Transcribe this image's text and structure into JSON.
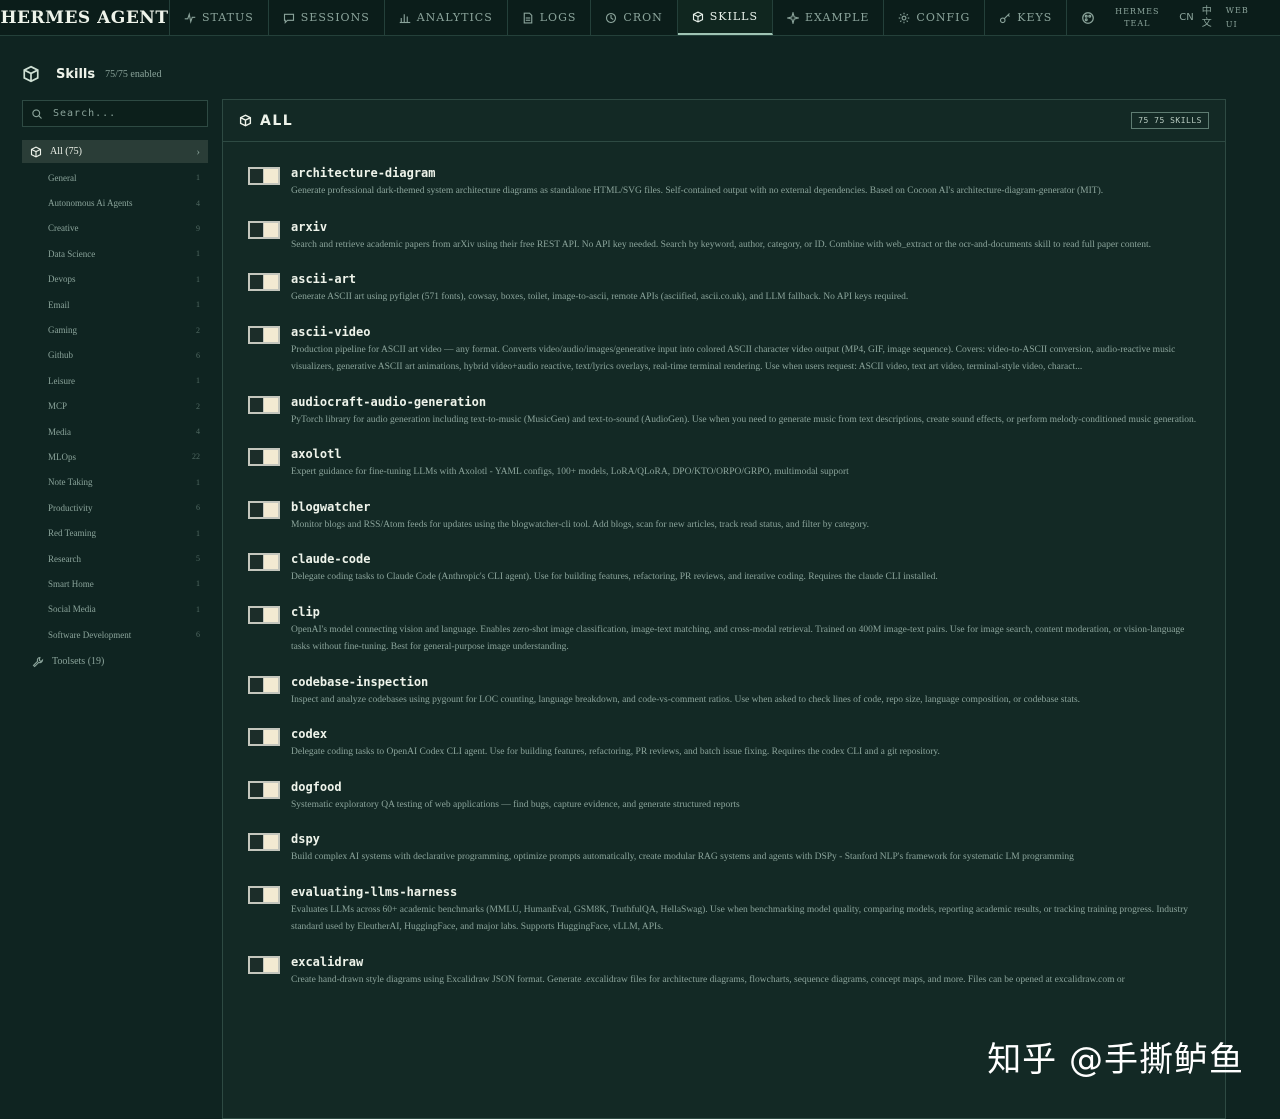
{
  "brand": "HERMES AGENT",
  "nav": {
    "tabs": [
      {
        "label": "STATUS",
        "icon": "pulse-icon"
      },
      {
        "label": "SESSIONS",
        "icon": "chat-icon"
      },
      {
        "label": "ANALYTICS",
        "icon": "bar-chart-icon"
      },
      {
        "label": "LOGS",
        "icon": "document-icon"
      },
      {
        "label": "CRON",
        "icon": "clock-icon"
      },
      {
        "label": "SKILLS",
        "icon": "cube-icon",
        "active": true
      },
      {
        "label": "EXAMPLE",
        "icon": "sparkle-icon"
      },
      {
        "label": "CONFIG",
        "icon": "gear-icon"
      },
      {
        "label": "KEYS",
        "icon": "key-icon"
      }
    ],
    "theme_line1": "HERMES",
    "theme_line2": "TEAL",
    "lang_en": "CN",
    "lang_zh": "中文",
    "webui_line1": "WEB",
    "webui_line2": "UI"
  },
  "page": {
    "title": "Skills",
    "enabled_count": "75/75 enabled"
  },
  "sidebar": {
    "search_placeholder": "Search...",
    "all_label": "All (75)",
    "categories": [
      {
        "label": "General",
        "count": "1"
      },
      {
        "label": "Autonomous Ai Agents",
        "count": "4"
      },
      {
        "label": "Creative",
        "count": "9"
      },
      {
        "label": "Data Science",
        "count": "1"
      },
      {
        "label": "Devops",
        "count": "1"
      },
      {
        "label": "Email",
        "count": "1"
      },
      {
        "label": "Gaming",
        "count": "2"
      },
      {
        "label": "Github",
        "count": "6"
      },
      {
        "label": "Leisure",
        "count": "1"
      },
      {
        "label": "MCP",
        "count": "2"
      },
      {
        "label": "Media",
        "count": "4"
      },
      {
        "label": "MLOps",
        "count": "22"
      },
      {
        "label": "Note Taking",
        "count": "1"
      },
      {
        "label": "Productivity",
        "count": "6"
      },
      {
        "label": "Red Teaming",
        "count": "1"
      },
      {
        "label": "Research",
        "count": "5"
      },
      {
        "label": "Smart Home",
        "count": "1"
      },
      {
        "label": "Social Media",
        "count": "1"
      },
      {
        "label": "Software Development",
        "count": "6"
      }
    ],
    "toolsets_label": "Toolsets (19)"
  },
  "panel": {
    "title": "ALL",
    "badge": "75 75 SKILLS"
  },
  "skills": [
    {
      "name": "architecture-diagram",
      "enabled": true,
      "desc": "Generate professional dark-themed system architecture diagrams as standalone HTML/SVG files. Self-contained output with no external dependencies. Based on Cocoon AI's architecture-diagram-generator (MIT)."
    },
    {
      "name": "arxiv",
      "enabled": true,
      "desc": "Search and retrieve academic papers from arXiv using their free REST API. No API key needed. Search by keyword, author, category, or ID. Combine with web_extract or the ocr-and-documents skill to read full paper content."
    },
    {
      "name": "ascii-art",
      "enabled": true,
      "desc": "Generate ASCII art using pyfiglet (571 fonts), cowsay, boxes, toilet, image-to-ascii, remote APIs (asciified, ascii.co.uk), and LLM fallback. No API keys required."
    },
    {
      "name": "ascii-video",
      "enabled": true,
      "desc": "Production pipeline for ASCII art video — any format. Converts video/audio/images/generative input into colored ASCII character video output (MP4, GIF, image sequence). Covers: video-to-ASCII conversion, audio-reactive music visualizers, generative ASCII art animations, hybrid video+audio reactive, text/lyrics overlays, real-time terminal rendering. Use when users request: ASCII video, text art video, terminal-style video, charact..."
    },
    {
      "name": "audiocraft-audio-generation",
      "enabled": true,
      "desc": "PyTorch library for audio generation including text-to-music (MusicGen) and text-to-sound (AudioGen). Use when you need to generate music from text descriptions, create sound effects, or perform melody-conditioned music generation."
    },
    {
      "name": "axolotl",
      "enabled": true,
      "desc": "Expert guidance for fine-tuning LLMs with Axolotl - YAML configs, 100+ models, LoRA/QLoRA, DPO/KTO/ORPO/GRPO, multimodal support"
    },
    {
      "name": "blogwatcher",
      "enabled": true,
      "desc": "Monitor blogs and RSS/Atom feeds for updates using the blogwatcher-cli tool. Add blogs, scan for new articles, track read status, and filter by category."
    },
    {
      "name": "claude-code",
      "enabled": true,
      "desc": "Delegate coding tasks to Claude Code (Anthropic's CLI agent). Use for building features, refactoring, PR reviews, and iterative coding. Requires the claude CLI installed."
    },
    {
      "name": "clip",
      "enabled": true,
      "desc": "OpenAI's model connecting vision and language. Enables zero-shot image classification, image-text matching, and cross-modal retrieval. Trained on 400M image-text pairs. Use for image search, content moderation, or vision-language tasks without fine-tuning. Best for general-purpose image understanding."
    },
    {
      "name": "codebase-inspection",
      "enabled": true,
      "desc": "Inspect and analyze codebases using pygount for LOC counting, language breakdown, and code-vs-comment ratios. Use when asked to check lines of code, repo size, language composition, or codebase stats."
    },
    {
      "name": "codex",
      "enabled": true,
      "desc": "Delegate coding tasks to OpenAI Codex CLI agent. Use for building features, refactoring, PR reviews, and batch issue fixing. Requires the codex CLI and a git repository."
    },
    {
      "name": "dogfood",
      "enabled": true,
      "desc": "Systematic exploratory QA testing of web applications — find bugs, capture evidence, and generate structured reports"
    },
    {
      "name": "dspy",
      "enabled": true,
      "desc": "Build complex AI systems with declarative programming, optimize prompts automatically, create modular RAG systems and agents with DSPy - Stanford NLP's framework for systematic LM programming"
    },
    {
      "name": "evaluating-llms-harness",
      "enabled": true,
      "desc": "Evaluates LLMs across 60+ academic benchmarks (MMLU, HumanEval, GSM8K, TruthfulQA, HellaSwag). Use when benchmarking model quality, comparing models, reporting academic results, or tracking training progress. Industry standard used by EleutherAI, HuggingFace, and major labs. Supports HuggingFace, vLLM, APIs."
    },
    {
      "name": "excalidraw",
      "enabled": true,
      "desc": "Create hand-drawn style diagrams using Excalidraw JSON format. Generate .excalidraw files for architecture diagrams, flowcharts, sequence diagrams, concept maps, and more. Files can be opened at excalidraw.com or"
    }
  ],
  "watermark": "知乎 @手撕鲈鱼"
}
